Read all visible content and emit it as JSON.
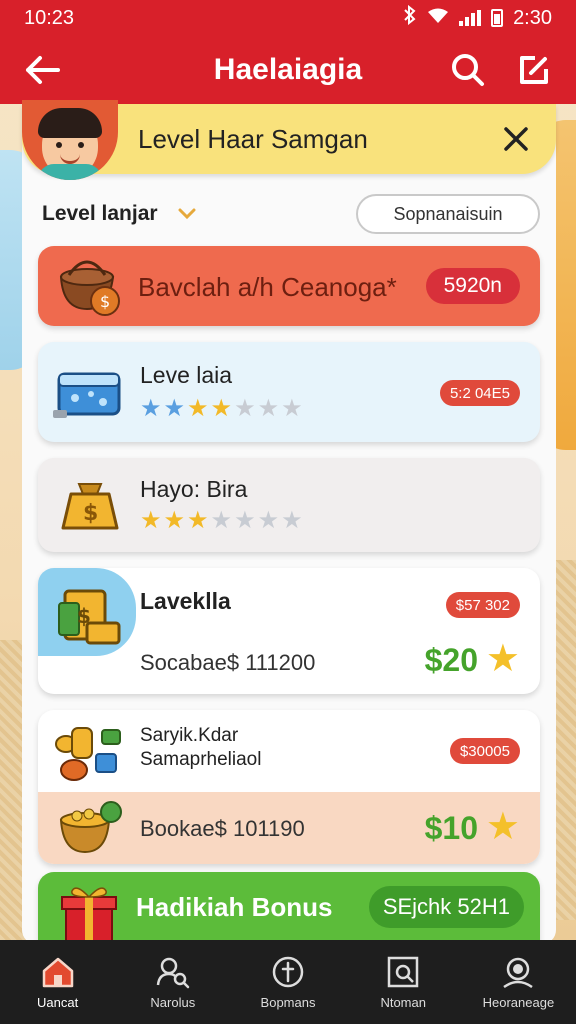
{
  "status_bar": {
    "time": "10:23",
    "battery_time": "2:30"
  },
  "app_bar": {
    "title": "Haelaiagia"
  },
  "banner": {
    "title": "Level Haar Samgan"
  },
  "filter": {
    "label": "Level lanjar",
    "button": "Sopnanaisuin"
  },
  "cards": [
    {
      "title": "Bavclah a/h Ceanoga*",
      "price": "5920n"
    },
    {
      "title": "Leve laia",
      "price": "5:2 04E5",
      "rating": 2.5,
      "max_rating": 6
    },
    {
      "title": "Hayo: Bira",
      "rating": 2.5,
      "max_rating": 6
    },
    {
      "title": "Laveklla",
      "price": "$57 302",
      "sub": "Socabae$ 111200",
      "amount": "$20"
    },
    {
      "title_line1": "Saryik.Kdar",
      "title_line2": "Samaprheliaol",
      "price": "$30005",
      "sub": "Bookae$ 101190",
      "amount": "$10"
    },
    {
      "title": "Hadikiah Bonus",
      "chip": "SEjchk 52H1"
    }
  ],
  "bottom_nav": [
    {
      "label": "Uancat",
      "icon": "home-icon",
      "active": true
    },
    {
      "label": "Narolus",
      "icon": "user-search-icon"
    },
    {
      "label": "Bopmans",
      "icon": "compass-icon"
    },
    {
      "label": "Ntoman",
      "icon": "photo-frame-icon"
    },
    {
      "label": "Heoraneage",
      "icon": "profile-icon"
    }
  ],
  "colors": {
    "primary": "#d8202a",
    "accent_green": "#45a32b",
    "star": "#f2b928"
  }
}
